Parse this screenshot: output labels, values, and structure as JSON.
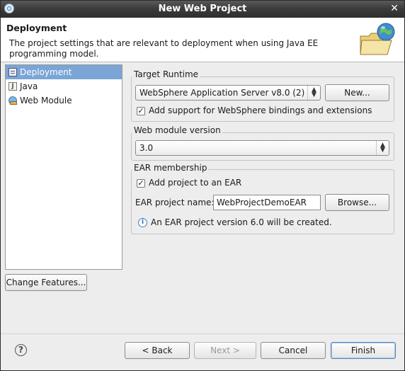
{
  "window": {
    "title": "New Web Project"
  },
  "banner": {
    "heading": "Deployment",
    "description": "The project settings that are relevant to deployment when using Java EE programming model.",
    "icon": "folder-globe-icon"
  },
  "tree": {
    "items": [
      {
        "label": "Deployment",
        "icon": "deployment-icon",
        "selected": true
      },
      {
        "label": "Java",
        "icon": "java-icon",
        "selected": false
      },
      {
        "label": "Web Module",
        "icon": "web-module-icon",
        "selected": false
      }
    ]
  },
  "change_features_label": "Change Features...",
  "target_runtime": {
    "group_label": "Target Runtime",
    "selected": "WebSphere Application Server v8.0 (2)",
    "new_button": "New...",
    "bindings_checkbox_label": "Add support for WebSphere bindings and extensions",
    "bindings_checked": true
  },
  "web_module_version": {
    "group_label": "Web module version",
    "selected": "3.0"
  },
  "ear": {
    "group_label": "EAR membership",
    "add_checkbox_label": "Add project to an EAR",
    "add_checked": true,
    "project_name_label": "EAR project name:",
    "project_name_value": "WebProjectDemoEAR",
    "browse_button": "Browse...",
    "info_text": "An EAR project version 6.0 will be created."
  },
  "footer": {
    "back": "< Back",
    "next": "Next >",
    "cancel": "Cancel",
    "finish": "Finish"
  }
}
